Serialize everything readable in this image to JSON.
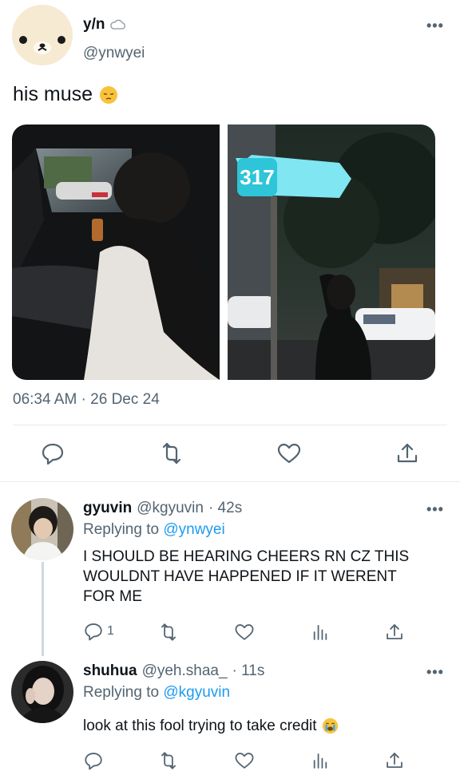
{
  "tweet": {
    "display_name": "y/n",
    "verified_icon": "cloud-icon",
    "handle": "@ynwyei",
    "text": "his muse",
    "emoji": "pensive-face",
    "timestamp": "06:34 AM · 26 Dec 24",
    "image_sign_number": "317",
    "actions": [
      "reply-icon",
      "retweet-icon",
      "like-icon",
      "share-icon"
    ]
  },
  "replies": [
    {
      "display_name": "gyuvin",
      "handle": "@kgyuvin",
      "time": "· 42s",
      "replying_prefix": "Replying to",
      "replying_to": "@ynwyei",
      "text_lines": [
        "I SHOULD BE HEARING CHEERS RN CZ THIS",
        "WOULDNT HAVE HAPPENED IF IT WERENT",
        "FOR ME"
      ],
      "reply_count": "1"
    },
    {
      "display_name": "shuhua",
      "handle": "@yeh.shaa_",
      "time": "· 11s",
      "replying_prefix": "Replying to",
      "replying_to": "@kgyuvin",
      "text": "look at this fool trying to take credit",
      "emoji": "crying-face"
    }
  ],
  "colors": {
    "accent": "#1d9bf0",
    "text": "#0f1419",
    "secondary": "#536471",
    "divider": "#e6ecf0",
    "sign": "#7fe6f2"
  }
}
